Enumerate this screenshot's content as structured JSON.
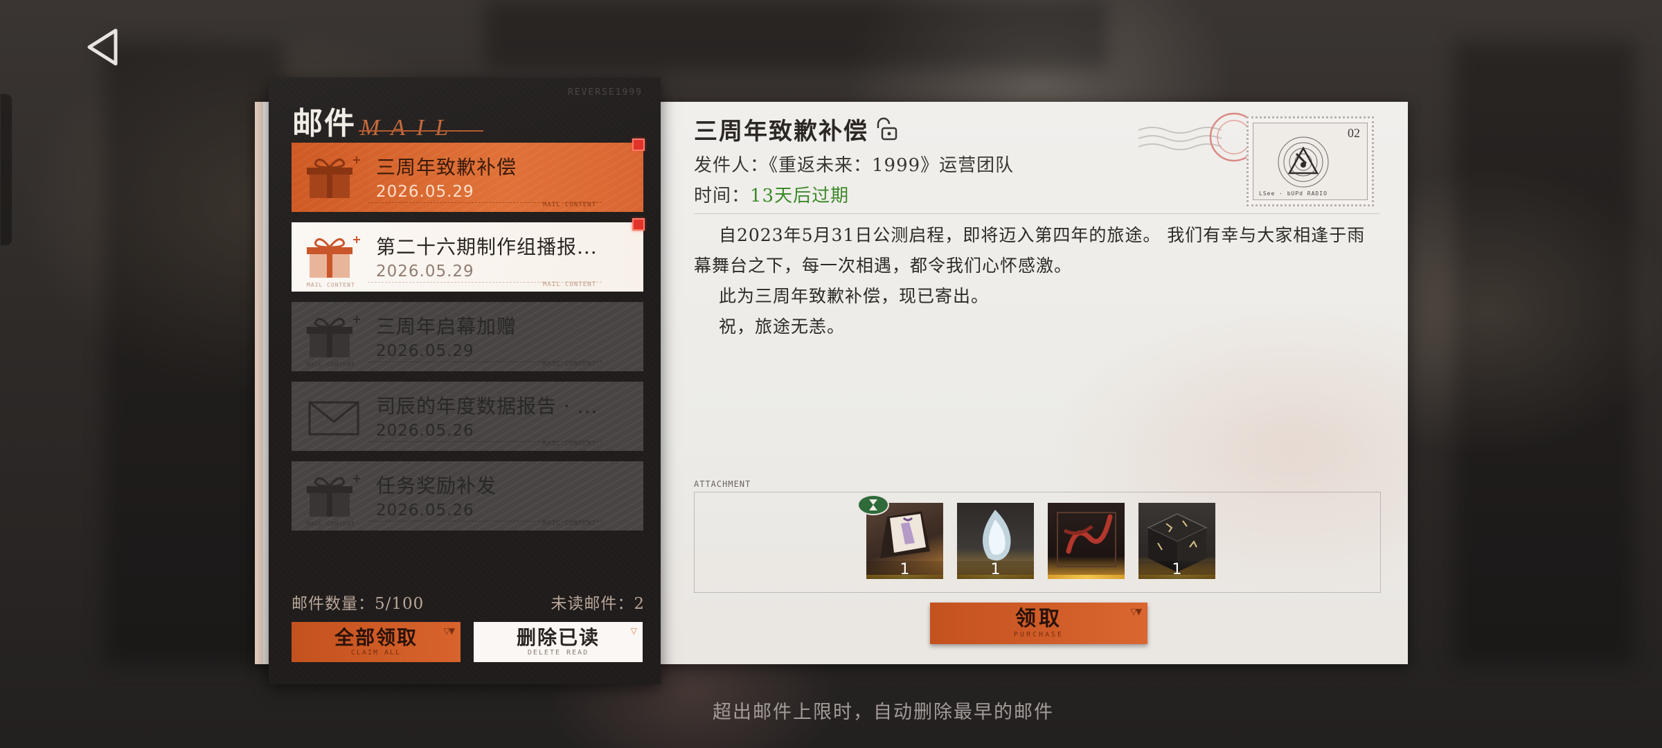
{
  "panel": {
    "title_cn": "邮件",
    "title_en": "MAIL",
    "brand_tag": "REVERSE1999"
  },
  "mails": [
    {
      "title": "三周年致歉补偿",
      "date": "2026.05.29",
      "state": "active",
      "icon": "gift-icon",
      "tag": "MAIL CONTENT",
      "unread": true
    },
    {
      "title": "第二十六期制作组播报...",
      "date": "2026.05.29",
      "state": "unread",
      "icon": "gift-icon",
      "tag": "MAIL CONTENT",
      "tag_left": "MAIL CONTENT",
      "unread": true
    },
    {
      "title": "三周年启幕加赠",
      "date": "2026.05.29",
      "state": "read",
      "icon": "gift-icon",
      "tag": "MAIL CONTENT",
      "tag_left": "MAIL CONTENT",
      "unread": false
    },
    {
      "title": "司辰的年度数据报告 · ...",
      "date": "2026.05.26",
      "state": "read",
      "icon": "envelope-icon",
      "tag": "MAIL CONTENT",
      "unread": false
    },
    {
      "title": "任务奖励补发",
      "date": "2026.05.26",
      "state": "read",
      "icon": "gift-icon",
      "tag": "MAIL CONTENT",
      "tag_left": "MAIL CONTENT",
      "unread": false
    }
  ],
  "counts": {
    "mail_count": "邮件数量：5/100",
    "unread_count": "未读邮件：2"
  },
  "buttons": {
    "claim_all": "全部领取",
    "claim_all_sub": "CLAIM ALL",
    "delete_read": "删除已读",
    "delete_read_sub": "DELETE READ",
    "claim": "领取",
    "claim_sub": "PURCHASE"
  },
  "detail": {
    "title": "三周年致歉补偿",
    "sender": "发件人：《重返未来：1999》运营团队",
    "time_label": "时间：",
    "time_value": "13天后过期",
    "body": [
      "自2023年5月31日公测启程，即将迈入第四年的旅途。 我们有幸与大家相逢于雨幕舞台之下，每一次相遇，都令我们心怀感激。",
      "此为三周年致歉补偿，现已寄出。",
      "祝，旅途无恙。"
    ]
  },
  "stamp": {
    "number": "02",
    "footer": "LSee · bUPd RADIO"
  },
  "attachment": {
    "label": "ATTACHMENT",
    "items": [
      {
        "name": "costume-book-item",
        "count": "1"
      },
      {
        "name": "water-spirit-item",
        "count": "1"
      },
      {
        "name": "serpent-card-item",
        "count": ""
      },
      {
        "name": "rune-box-item",
        "count": "1"
      }
    ]
  },
  "footer_note": "超出邮件上限时，自动删除最早的邮件",
  "colors": {
    "accent": "#d8632c",
    "expire_green": "#3b8a2a",
    "unread_red": "#e0342a"
  }
}
